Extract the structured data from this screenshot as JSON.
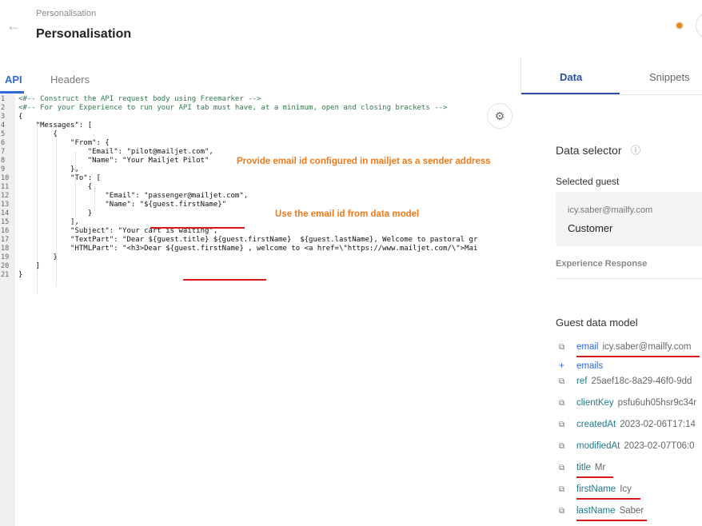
{
  "header": {
    "breadcrumb": "Personalisation",
    "title": "Personalisation",
    "back_icon": "←",
    "settings_icon": "✹"
  },
  "left_tabs": {
    "api": "API",
    "headers": "Headers"
  },
  "editor": {
    "line_numbers": [
      "1",
      "2",
      "3",
      "4",
      "5",
      "6",
      "7",
      "8",
      "9",
      "10",
      "11",
      "12",
      "13",
      "14",
      "15",
      "16",
      "17",
      "18",
      "19",
      "20",
      "21"
    ],
    "lines": [
      "<#-- Construct the API request body using Freemarker -->",
      "<#-- For your Experience to run your API tab must have, at a minimum, open and closing brackets -->",
      "{",
      "    \"Messages\": [",
      "        {",
      "            \"From\": {",
      "                \"Email\": \"pilot@mailjet.com\",",
      "                \"Name\": \"Your Mailjet Pilot\"",
      "            },",
      "            \"To\": [",
      "                {",
      "                    \"Email\": \"passenger@mailjet.com\",",
      "                    \"Name\": \"${guest.firstName}\"",
      "                }",
      "            ],",
      "            \"Subject\": \"Your cart is waiting\",",
      "            \"TextPart\": \"Dear ${guest.title} ${guest.firstName}  ${guest.lastName}, Welcome to pastoral gr",
      "            \"HTMLPart\": \"<h3>Dear ${guest.firstName} , welcome to <a href=\\\"https://www.mailjet.com/\\\">Mai",
      "        }",
      "    ]",
      "}"
    ],
    "annotation_sender": "Provide email id configured in mailjet as a sender address",
    "annotation_datamodel": "Use the email id from data model",
    "settings_icon": "⚙"
  },
  "right_tabs": {
    "data": "Data",
    "snippets": "Snippets"
  },
  "data_panel": {
    "selector_title": "Data selector",
    "info_icon": "ⓘ",
    "selected_guest_label": "Selected guest",
    "guest_email": "icy.saber@mailfy.com",
    "guest_type": "Customer",
    "experience_response": "Experience Response",
    "guest_data_model_title": "Guest data model",
    "fields": [
      {
        "key": "email",
        "value": "icy.saber@mailfy.com",
        "icon": "⧉"
      },
      {
        "key": "emails",
        "value": "",
        "icon": "+"
      },
      {
        "key": "ref",
        "value": "25aef18c-8a29-46f0-9dd",
        "icon": "⧉"
      },
      {
        "key": "clientKey",
        "value": "psfu6uh05hsr9c34r",
        "icon": "⧉"
      },
      {
        "key": "createdAt",
        "value": "2023-02-06T17:14",
        "icon": "⧉"
      },
      {
        "key": "modifiedAt",
        "value": "2023-02-07T06:0",
        "icon": "⧉"
      },
      {
        "key": "title",
        "value": "Mr",
        "icon": "⧉"
      },
      {
        "key": "firstName",
        "value": "Icy",
        "icon": "⧉"
      },
      {
        "key": "lastName",
        "value": "Saber",
        "icon": "⧉"
      }
    ]
  },
  "colors": {
    "accent": "#2e6ad6",
    "annotation": "#f07a1a",
    "underline": "#d91a1a",
    "comment": "#2f7a4a"
  }
}
